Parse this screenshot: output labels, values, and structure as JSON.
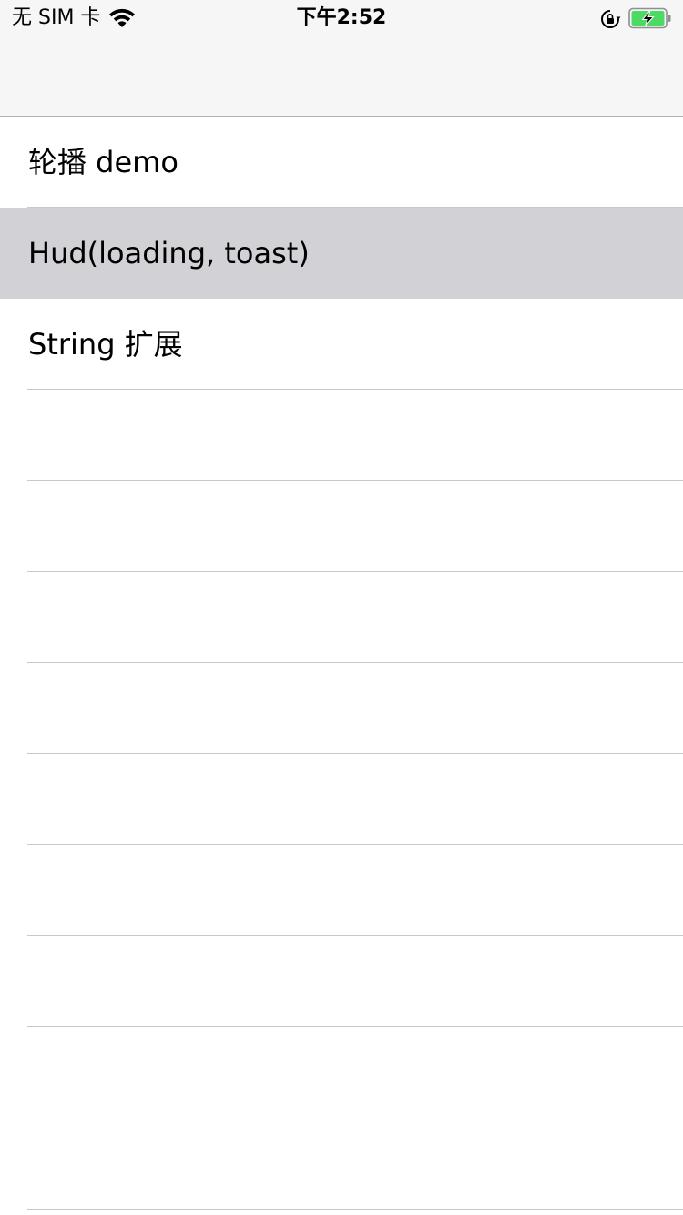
{
  "status_bar": {
    "carrier": "无 SIM 卡",
    "time": "下午2:52",
    "wifi_icon": "wifi-icon",
    "rotation_lock_icon": "rotation-lock-icon",
    "battery_icon": "battery-charging-icon",
    "battery_color": "#4cd964"
  },
  "navbar": {
    "background": "#f6f6f6"
  },
  "table": {
    "rows": [
      {
        "label": "轮播 demo",
        "selected": false
      },
      {
        "label": "Hud(loading, toast)",
        "selected": true
      },
      {
        "label": "String 扩展",
        "selected": false
      }
    ],
    "selected_color": "#d1d1d6",
    "separator_color": "#c8c7cc"
  }
}
